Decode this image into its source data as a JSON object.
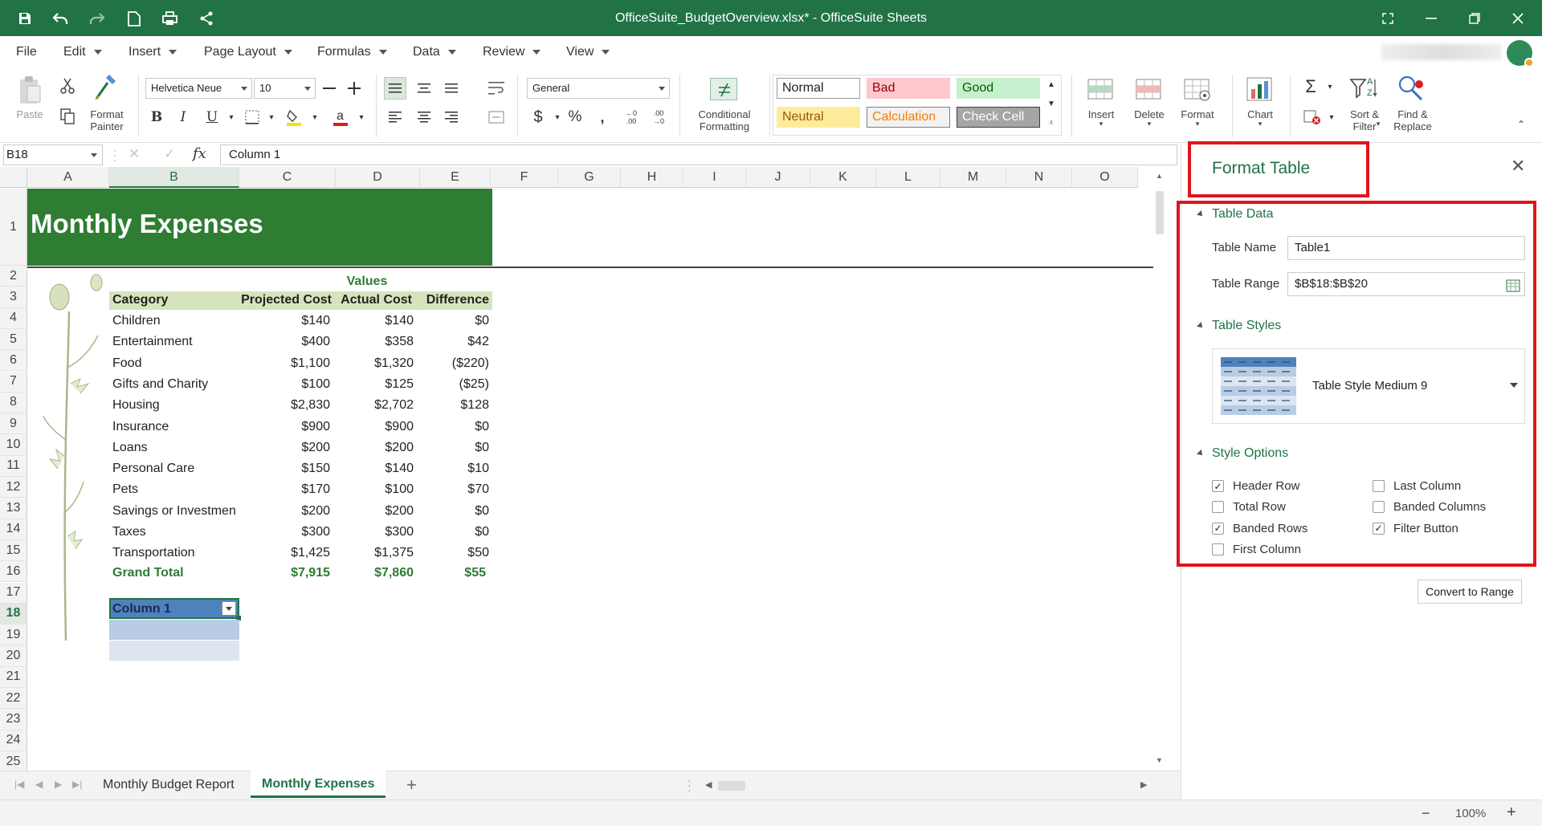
{
  "window": {
    "title": "OfficeSuite_BudgetOverview.xlsx* - OfficeSuite Sheets",
    "accent": "#217346"
  },
  "quick_access": [
    "save-icon",
    "undo-icon",
    "redo-icon",
    "new-document-icon",
    "print-icon",
    "share-icon"
  ],
  "menu": [
    "File",
    "Edit",
    "Insert",
    "Page Layout",
    "Formulas",
    "Data",
    "Review",
    "View"
  ],
  "ribbon": {
    "paste": "Paste",
    "format_painter": "Format\nPainter",
    "font_name": "Helvetica Neue",
    "font_size": "10",
    "number_format": "General",
    "conditional_formatting": "Conditional\nFormatting",
    "cell_styles": [
      {
        "label": "Normal",
        "bg": "#ffffff",
        "fg": "#222222",
        "border": "#9a9a9a"
      },
      {
        "label": "Bad",
        "bg": "#ffc7ce",
        "fg": "#9c0006",
        "border": "#ffc7ce"
      },
      {
        "label": "Good",
        "bg": "#c6efce",
        "fg": "#006100",
        "border": "#c6efce"
      },
      {
        "label": "Neutral",
        "bg": "#ffeb9c",
        "fg": "#9c5700",
        "border": "#ffeb9c"
      },
      {
        "label": "Calculation",
        "bg": "#f2f2f2",
        "fg": "#fa7d00",
        "border": "#7f7f7f"
      },
      {
        "label": "Check Cell",
        "bg": "#a5a5a5",
        "fg": "#ffffff",
        "border": "#3f3f3f"
      }
    ],
    "insert": "Insert",
    "delete": "Delete",
    "format": "Format",
    "chart": "Chart",
    "sort_filter": "Sort &\nFilter",
    "find_replace": "Find &\nReplace"
  },
  "formula_bar": {
    "name_box": "B18",
    "fx": "fx",
    "content": "Column 1"
  },
  "columns": [
    "A",
    "B",
    "C",
    "D",
    "E",
    "F",
    "G",
    "H",
    "I",
    "J",
    "K",
    "L",
    "M",
    "N",
    "O"
  ],
  "rows": [
    "1",
    "2",
    "3",
    "4",
    "5",
    "6",
    "7",
    "8",
    "9",
    "10",
    "11",
    "12",
    "13",
    "14",
    "15",
    "16",
    "17",
    "18",
    "19",
    "20",
    "21",
    "22",
    "23",
    "24",
    "25"
  ],
  "sheet": {
    "title": "Monthly Expenses",
    "values_label": "Values",
    "headers": [
      "Category",
      "Projected Cost",
      "Actual Cost",
      "Difference"
    ],
    "rows": [
      [
        "Children",
        "$140",
        "$140",
        "$0"
      ],
      [
        "Entertainment",
        "$400",
        "$358",
        "$42"
      ],
      [
        "Food",
        "$1,100",
        "$1,320",
        "($220)"
      ],
      [
        "Gifts and Charity",
        "$100",
        "$125",
        "($25)"
      ],
      [
        "Housing",
        "$2,830",
        "$2,702",
        "$128"
      ],
      [
        "Insurance",
        "$900",
        "$900",
        "$0"
      ],
      [
        "Loans",
        "$200",
        "$200",
        "$0"
      ],
      [
        "Personal Care",
        "$150",
        "$140",
        "$10"
      ],
      [
        "Pets",
        "$170",
        "$100",
        "$70"
      ],
      [
        "Savings or Investmen",
        "$200",
        "$200",
        "$0"
      ],
      [
        "Taxes",
        "$300",
        "$300",
        "$0"
      ],
      [
        "Transportation",
        "$1,425",
        "$1,375",
        "$50"
      ]
    ],
    "total": [
      "Grand Total",
      "$7,915",
      "$7,860",
      "$55"
    ],
    "new_table_header": "Column 1"
  },
  "sheet_tabs": [
    "Monthly Budget Report",
    "Monthly Expenses"
  ],
  "active_tab": "Monthly Expenses",
  "status": {
    "zoom": "100%"
  },
  "panel": {
    "title": "Format Table",
    "table_data": {
      "heading": "Table Data",
      "name_label": "Table Name",
      "name_value": "Table1",
      "range_label": "Table Range",
      "range_value": "$B$18:$B$20"
    },
    "table_styles": {
      "heading": "Table Styles",
      "selected": "Table Style Medium 9"
    },
    "style_options": {
      "heading": "Style Options",
      "options": [
        {
          "label": "Header Row",
          "checked": true
        },
        {
          "label": "Last Column",
          "checked": false
        },
        {
          "label": "Total Row",
          "checked": false
        },
        {
          "label": "Banded Columns",
          "checked": false
        },
        {
          "label": "Banded Rows",
          "checked": true
        },
        {
          "label": "Filter Button",
          "checked": true
        },
        {
          "label": "First Column",
          "checked": false
        }
      ]
    },
    "convert_button": "Convert to Range"
  }
}
